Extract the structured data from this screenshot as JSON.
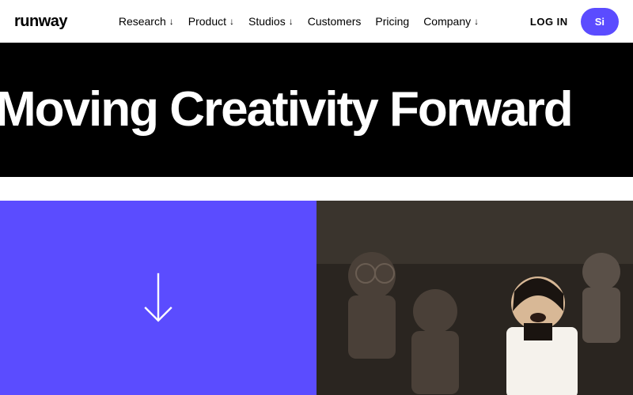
{
  "brand": "runway",
  "nav": {
    "research": "Research",
    "product": "Product",
    "studios": "Studios",
    "customers": "Customers",
    "pricing": "Pricing",
    "company": "Company"
  },
  "auth": {
    "login": "LOG IN",
    "signup": "Si"
  },
  "hero": {
    "headline": "Moving Creativity Forward"
  },
  "colors": {
    "accent": "#5b4cff",
    "heroBg": "#000000"
  }
}
